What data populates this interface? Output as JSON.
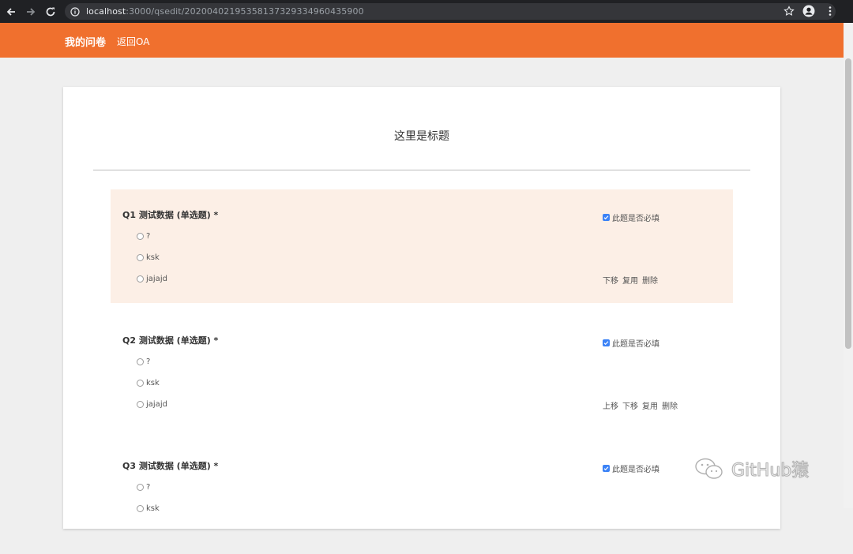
{
  "browser": {
    "url_host": "localhost",
    "url_rest": ":3000/qsedit/20200402195358137329334960435900"
  },
  "header": {
    "brand": "我的问卷",
    "back_link": "返回OA"
  },
  "survey": {
    "title": "这里是标题",
    "questions": [
      {
        "title": "Q1 测试数据 (单选题) *",
        "options": [
          "?",
          "ksk",
          "jajajd"
        ],
        "required_label": "此题是否必填",
        "required_checked": true,
        "actions": [
          "下移",
          "复用",
          "删除"
        ]
      },
      {
        "title": "Q2 测试数据 (单选题) *",
        "options": [
          "?",
          "ksk",
          "jajajd"
        ],
        "required_label": "此题是否必填",
        "required_checked": true,
        "actions": [
          "上移",
          "下移",
          "复用",
          "删除"
        ]
      },
      {
        "title": "Q3 测试数据 (单选题) *",
        "options": [
          "?",
          "ksk"
        ],
        "required_label": "此题是否必填",
        "required_checked": true,
        "actions": []
      }
    ]
  },
  "watermark": {
    "text": "GitHub猿"
  },
  "colors": {
    "header": "#f0702e",
    "active_question_bg": "#fcefe6",
    "checkbox": "#3b82f6"
  }
}
